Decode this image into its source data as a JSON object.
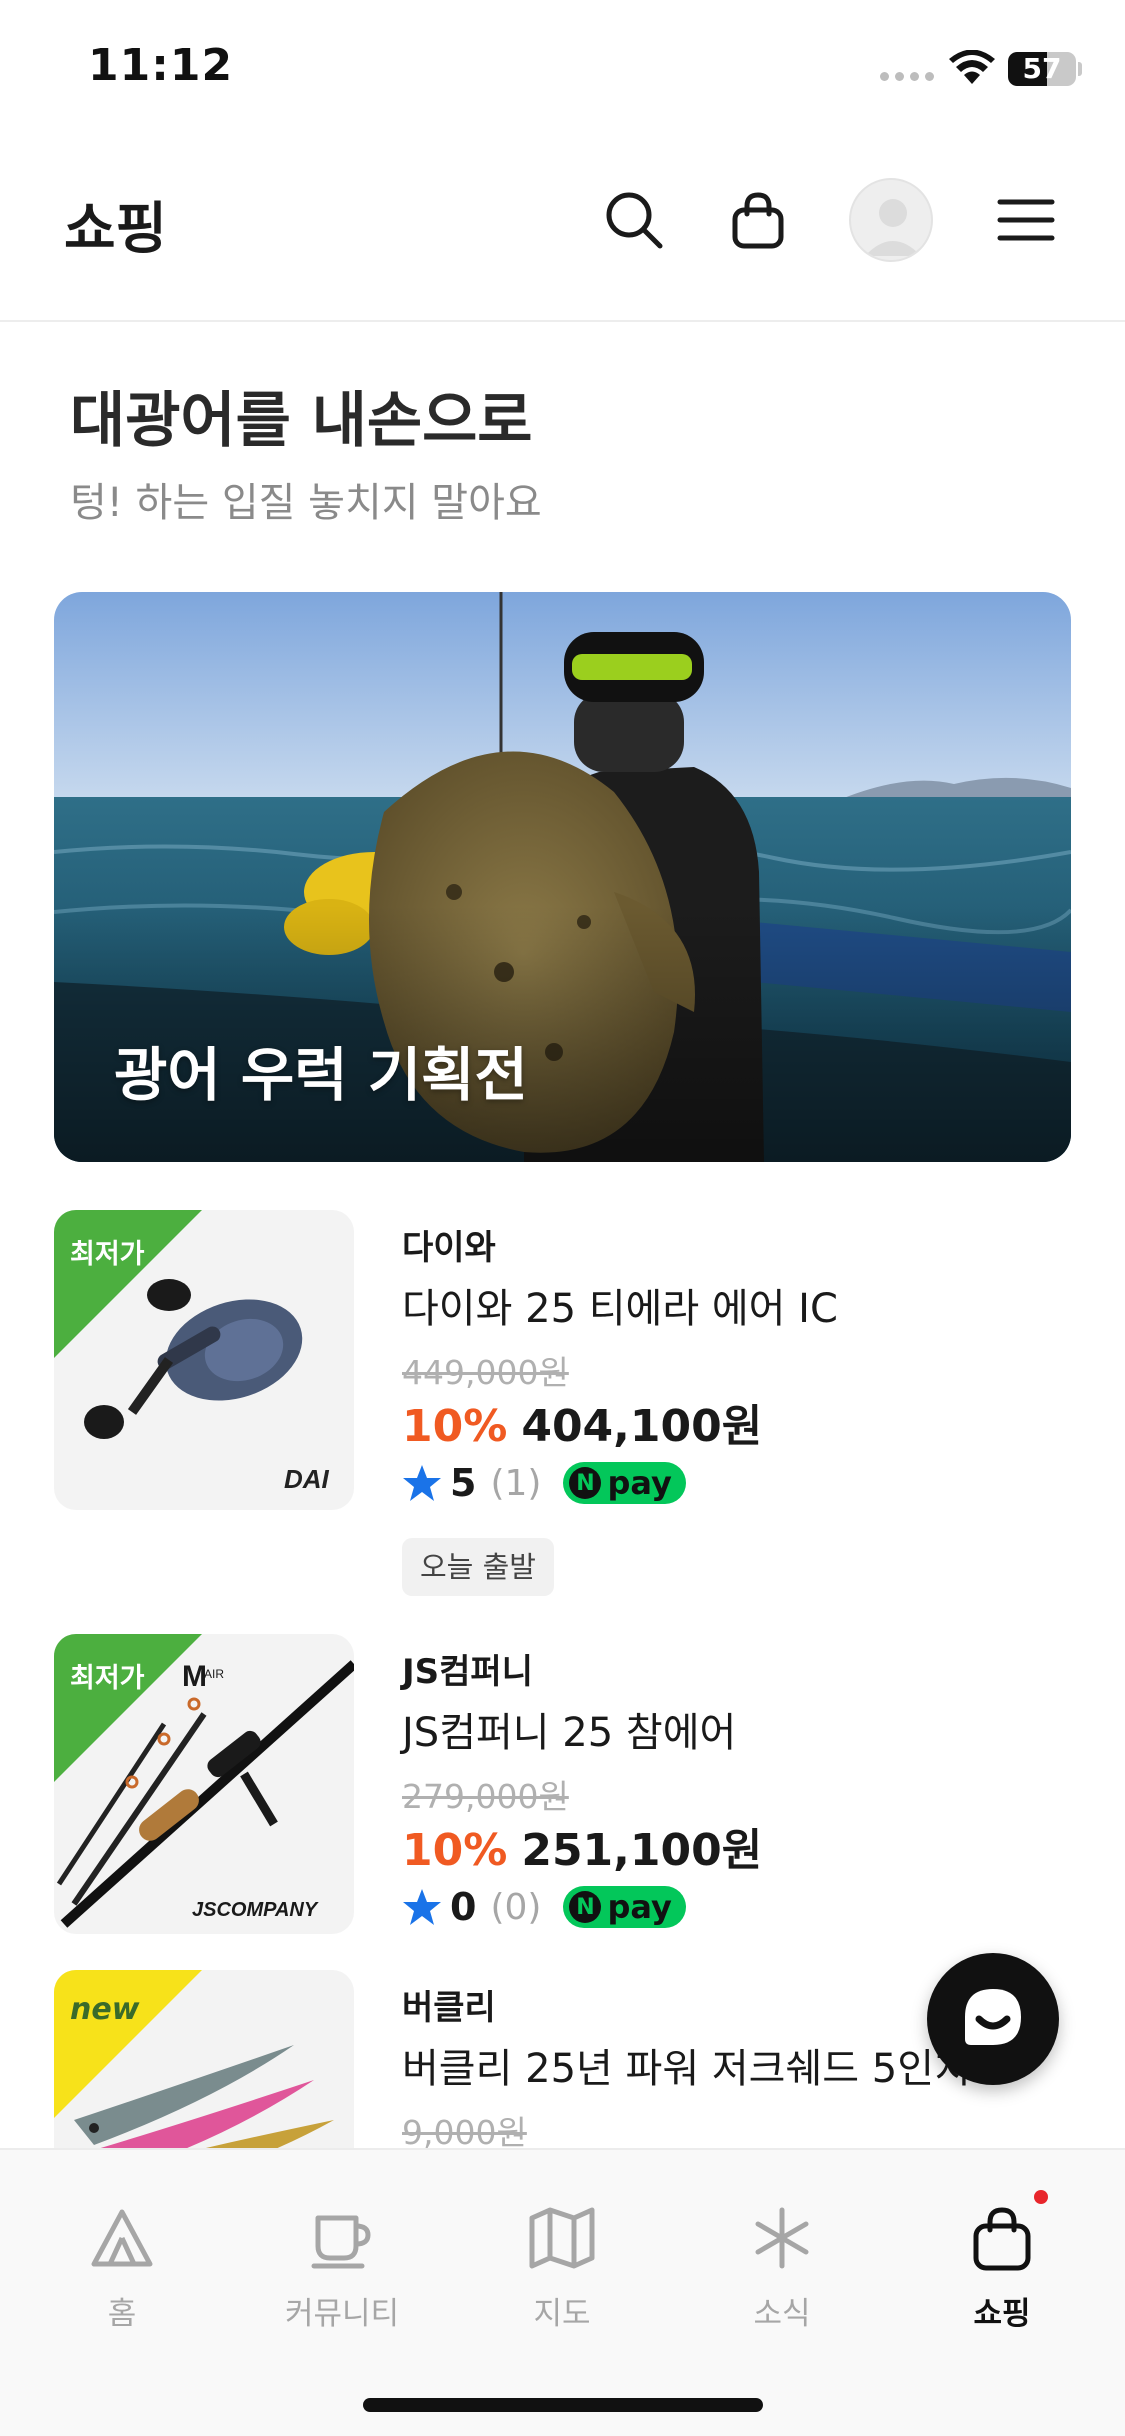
{
  "status_bar": {
    "time": "11:12",
    "battery": "57",
    "battery_level": 0.57
  },
  "header": {
    "title": "쇼핑"
  },
  "hero": {
    "title": "대광어를 내손으로",
    "subtitle": "텅! 하는 입질 놓치지 말아요"
  },
  "banner": {
    "label": "광어 우럭 기획전"
  },
  "products": [
    {
      "ribbon": "최저가",
      "brand": "다이와",
      "name": "다이와 25 티에라 에어 IC",
      "original_price": "449,000원",
      "discount": "10%",
      "price": "404,100원",
      "rating": "5",
      "review_count": "(1)",
      "npay_label": "pay",
      "tag": "오늘 출발"
    },
    {
      "ribbon": "최저가",
      "brand": "JS컴퍼니",
      "name": "JS컴퍼니 25 참에어",
      "original_price": "279,000원",
      "discount": "10%",
      "price": "251,100원",
      "rating": "0",
      "review_count": "(0)",
      "npay_label": "pay"
    },
    {
      "ribbon": "new",
      "brand": "버클리",
      "name": "버클리 25년 파워 저크쉐드 5인치",
      "original_price": "9,000원"
    }
  ],
  "bottom_nav": [
    {
      "label": "홈",
      "icon": "tent-icon"
    },
    {
      "label": "커뮤니티",
      "icon": "cup-icon"
    },
    {
      "label": "지도",
      "icon": "map-icon"
    },
    {
      "label": "소식",
      "icon": "asterisk-icon"
    },
    {
      "label": "쇼핑",
      "icon": "shopping-bag-icon",
      "active": true
    }
  ],
  "colors": {
    "discount": "#f05a22",
    "ribbon_lowest": "#4caf3f",
    "ribbon_new": "#f7e21a",
    "npay": "#03c75a",
    "star": "#1a73e8",
    "notification_dot": "#e8262c"
  }
}
